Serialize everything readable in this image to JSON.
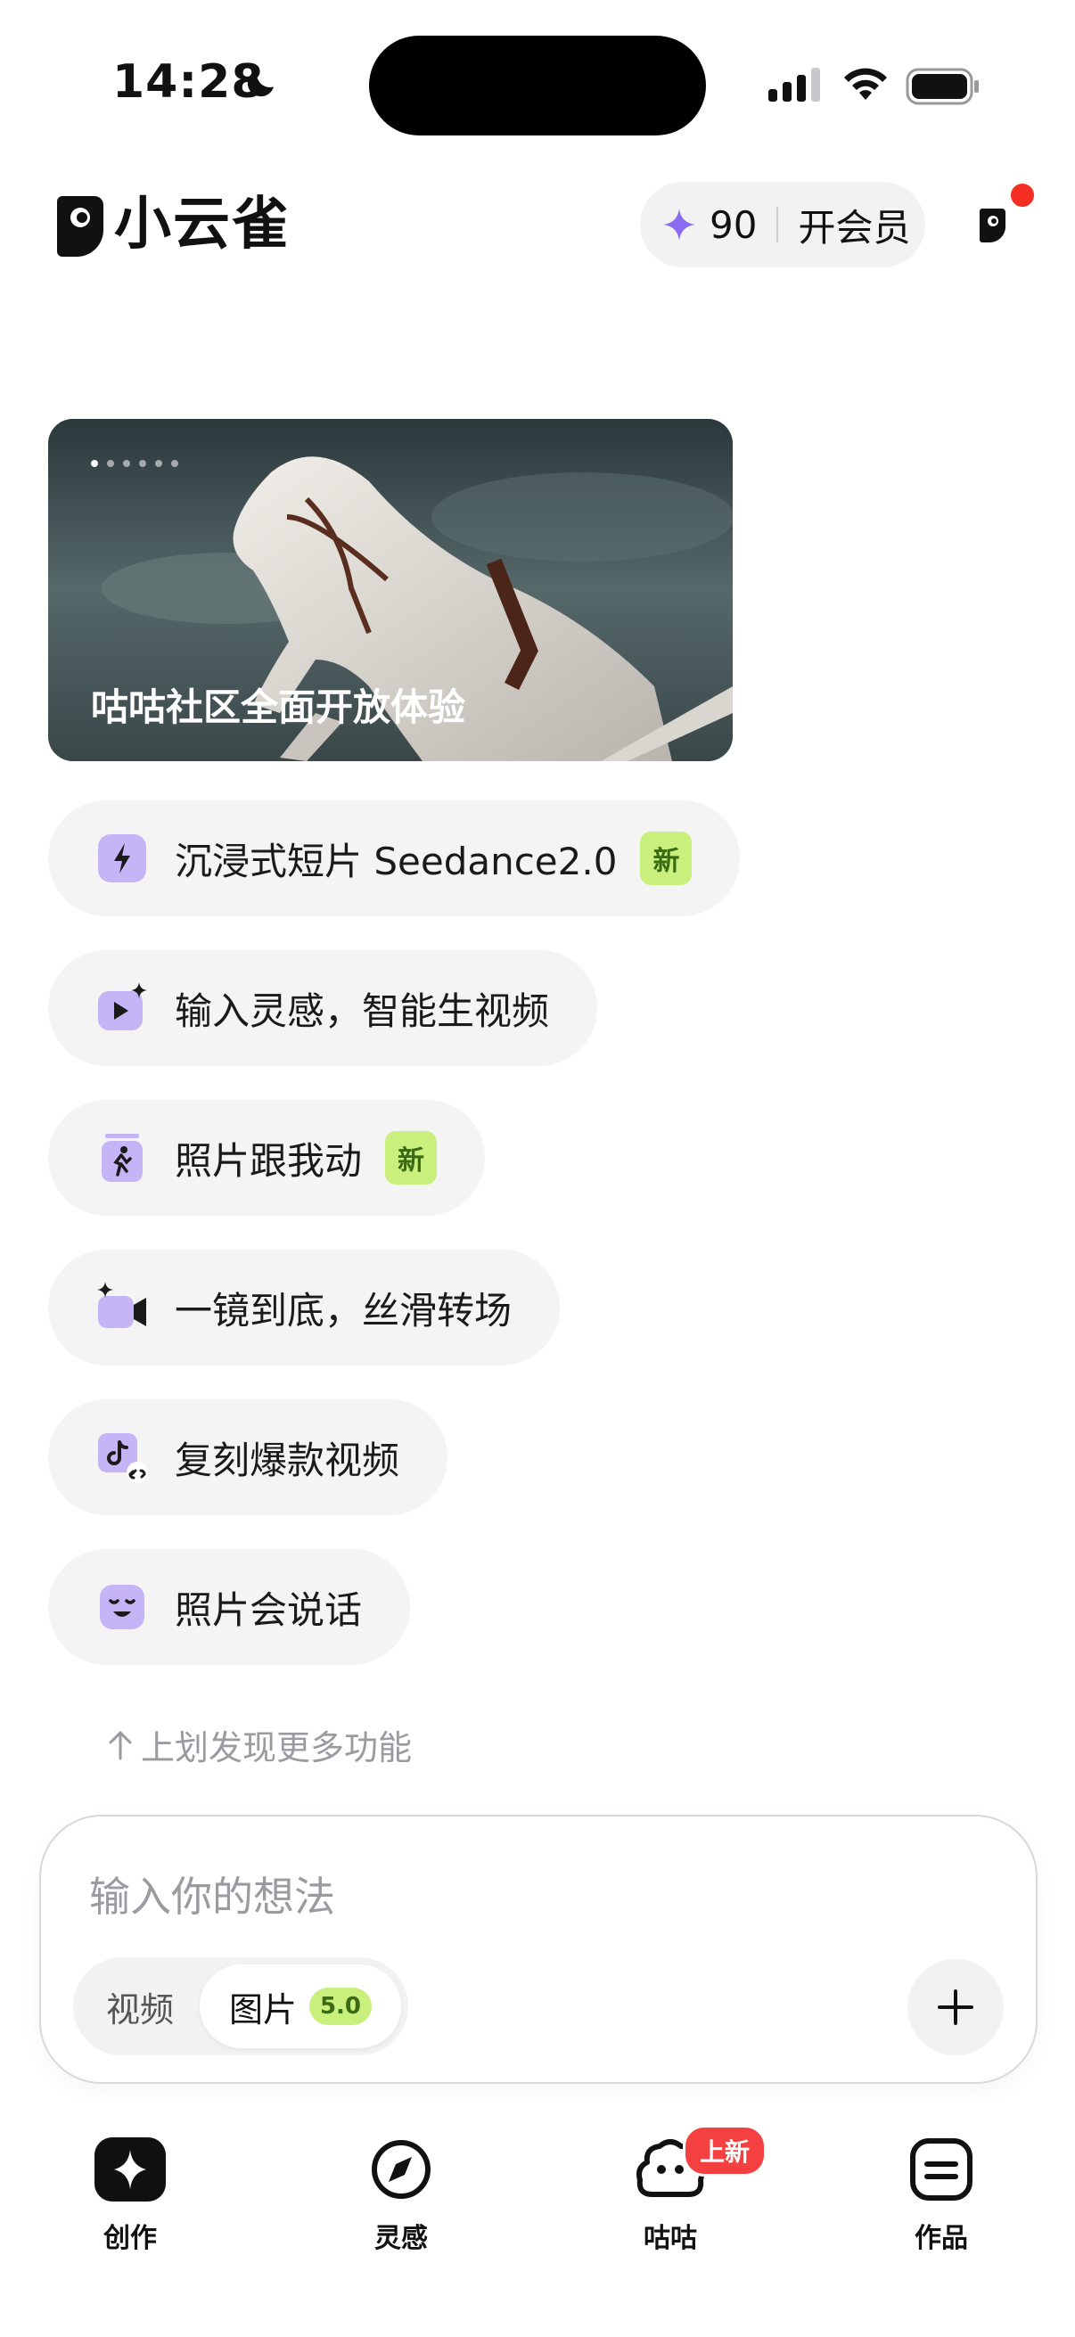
{
  "status_bar": {
    "time": "14:28"
  },
  "header": {
    "app_name": "小云雀",
    "points": "90",
    "vip_label": "开会员"
  },
  "banner": {
    "caption": "咕咕社区全面开放体验",
    "dot_count": 6,
    "active_dot": 0
  },
  "features": [
    {
      "label": "沉浸式短片 Seedance2.0",
      "badge": "新",
      "icon": "bolt-icon"
    },
    {
      "label": "输入灵感，智能生视频",
      "badge": "",
      "icon": "video-sparkle-icon"
    },
    {
      "label": "照片跟我动",
      "badge": "新",
      "icon": "dancing-photo-icon"
    },
    {
      "label": "一镜到底，丝滑转场",
      "badge": "",
      "icon": "camera-sparkle-icon"
    },
    {
      "label": "复刻爆款视频",
      "badge": "",
      "icon": "tiktok-link-icon"
    },
    {
      "label": "照片会说话",
      "badge": "",
      "icon": "talking-face-icon"
    }
  ],
  "hint": "上划发现更多功能",
  "composer": {
    "placeholder": "输入你的想法",
    "mode_video": "视频",
    "mode_image": "图片",
    "model_version": "5.0"
  },
  "tabs": [
    {
      "label": "创作",
      "icon": "sparkle-icon"
    },
    {
      "label": "灵感",
      "icon": "compass-icon"
    },
    {
      "label": "咕咕",
      "icon": "cloud-face-icon",
      "badge": "上新"
    },
    {
      "label": "作品",
      "icon": "works-icon"
    }
  ],
  "colors": {
    "accent_purple": "#8b6cf0",
    "chip_bg": "#f4f4f5",
    "new_badge_bg": "#c9f07d",
    "new_badge_text": "#3a6b14",
    "notification_red": "#f52d22"
  }
}
